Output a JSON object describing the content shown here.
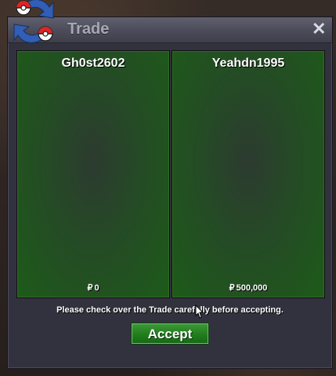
{
  "window": {
    "title": "Trade",
    "close_label": "✕"
  },
  "trade": {
    "left_panel": {
      "player": "Gh0st2602",
      "currency_symbol": "₽",
      "amount": "0"
    },
    "right_panel": {
      "player": "Yeahdn1995",
      "currency_symbol": "₽",
      "amount": "500,000"
    }
  },
  "footer": {
    "notice": "Please check over the Trade carefully before accepting.",
    "accept_label": "Accept"
  },
  "icons": {
    "logo": "trade-logo-icon",
    "close": "close-icon",
    "cursor": "mouse-cursor-icon"
  },
  "colors": {
    "window_bg": "#32323f",
    "titlebar": "#4b4b59",
    "panel_green": "#1d5b19",
    "accept_green": "#217d1c"
  }
}
